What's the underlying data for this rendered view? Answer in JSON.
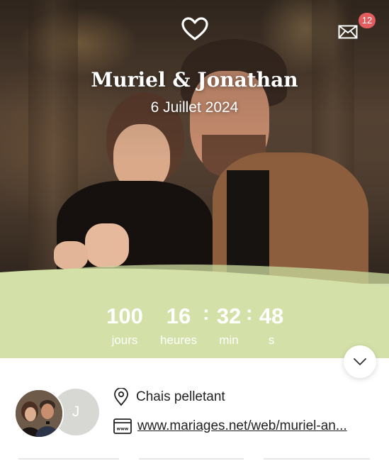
{
  "header": {
    "names": "Muriel & Jonathan",
    "date": "6 Juillet 2024",
    "heart_icon": "heart-outline-icon",
    "mail_icon": "envelope-icon",
    "mail_badge": "12"
  },
  "countdown": {
    "days": "100",
    "days_label": "jours",
    "hours": "16",
    "hours_label": "heures",
    "minutes": "32",
    "minutes_label": "min",
    "seconds": "48",
    "seconds_label": "s",
    "separator": ":"
  },
  "info": {
    "avatar_initial": "J",
    "location": "Chais pelletant",
    "location_icon": "map-pin-icon",
    "website": "www.mariages.net/web/muriel-an...",
    "website_icon": "browser-window-icon"
  },
  "colors": {
    "accent_green": "#d3e0a7",
    "badge_red": "#e25d5d",
    "avatar_gray": "#d7d8d3"
  }
}
